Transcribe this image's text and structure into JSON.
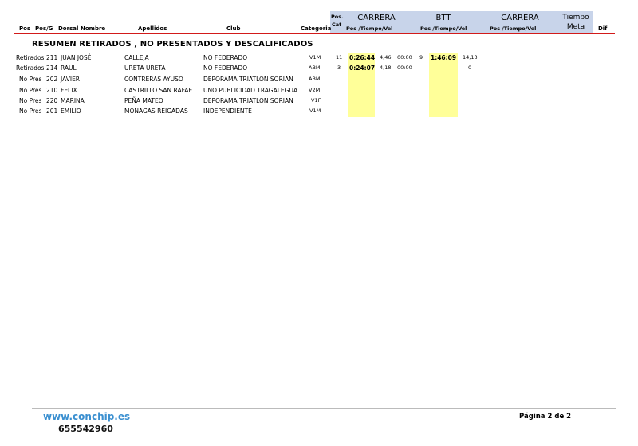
{
  "header": {
    "columns": {
      "pos": "Pos",
      "pos_g": "Pos/G",
      "dorsal": "Dorsal",
      "nombre": "Nombre",
      "apellidos": "Apellidos",
      "club": "Club",
      "categoria": "Categoria",
      "pos_cat_top": "Pos.",
      "pos_cat_bottom": "Cat"
    },
    "groups": {
      "carrera1": "CARRERA",
      "btt": "BTT",
      "carrera2": "CARRERA",
      "tiempo_top": "Tiempo",
      "tiempo_bottom": "Meta",
      "dif": "Dif"
    },
    "sub": {
      "carrera1": "Pos /Tiempo/Vel",
      "btt": "Pos /Tiempo/Vel",
      "carrera2": "Pos /Tiempo/Vel"
    },
    "accent_colors": {
      "band": "#c8d4ea",
      "red_line": "#d21a1a",
      "highlight": "#ffff99",
      "link": "#3a8fd0"
    }
  },
  "section_title": "RESUMEN RETIRADOS , NO PRESENTADOS Y DESCALIFICADOS",
  "rows": [
    {
      "status": "Retirados",
      "dorsal": "211",
      "nombre": "JUAN JOSÉ",
      "apellidos": "CALLEJA",
      "club": "NO FEDERADO",
      "categoria": "V1M",
      "pos_cat": "11",
      "c1_time": "0:26:44",
      "c1_vel": "4,46",
      "c1_extra": "00:00",
      "btt_pos": "9",
      "btt_time": "1:46:09",
      "btt_vel": "14,13"
    },
    {
      "status": "Retirados",
      "dorsal": "214",
      "nombre": "RAUL",
      "apellidos": "URETA URETA",
      "club": "NO FEDERADO",
      "categoria": "ABM",
      "pos_cat": "3",
      "c1_time": "0:24:07",
      "c1_vel": "4,18",
      "c1_extra": "00:00",
      "btt_pos": "",
      "btt_time": "",
      "btt_vel": "0"
    },
    {
      "status": "No Pres",
      "dorsal": "202",
      "nombre": "JAVIER",
      "apellidos": "CONTRERAS AYUSO",
      "club": "DEPORAMA TRIATLON SORIAN",
      "categoria": "ABM",
      "pos_cat": "",
      "c1_time": "",
      "c1_vel": "",
      "c1_extra": "",
      "btt_pos": "",
      "btt_time": "",
      "btt_vel": ""
    },
    {
      "status": "No Pres",
      "dorsal": "210",
      "nombre": "FELIX",
      "apellidos": "CASTRILLO SAN RAFAE",
      "club": "UNO PUBLICIDAD TRAGALEGUA",
      "categoria": "V2M",
      "pos_cat": "",
      "c1_time": "",
      "c1_vel": "",
      "c1_extra": "",
      "btt_pos": "",
      "btt_time": "",
      "btt_vel": ""
    },
    {
      "status": "No Pres",
      "dorsal": "220",
      "nombre": "MARINA",
      "apellidos": "PEÑA MATEO",
      "club": "DEPORAMA TRIATLON SORIAN",
      "categoria": "V1F",
      "pos_cat": "",
      "c1_time": "",
      "c1_vel": "",
      "c1_extra": "",
      "btt_pos": "",
      "btt_time": "",
      "btt_vel": ""
    },
    {
      "status": "No Pres",
      "dorsal": "201",
      "nombre": "EMILIO",
      "apellidos": "MONAGAS REIGADAS",
      "club": "INDEPENDIENTE",
      "categoria": "V1M",
      "pos_cat": "",
      "c1_time": "",
      "c1_vel": "",
      "c1_extra": "",
      "btt_pos": "",
      "btt_time": "",
      "btt_vel": ""
    }
  ],
  "footer": {
    "url": "www.conchip.es",
    "phone": "655542960",
    "page": "Página 2 de 2"
  }
}
